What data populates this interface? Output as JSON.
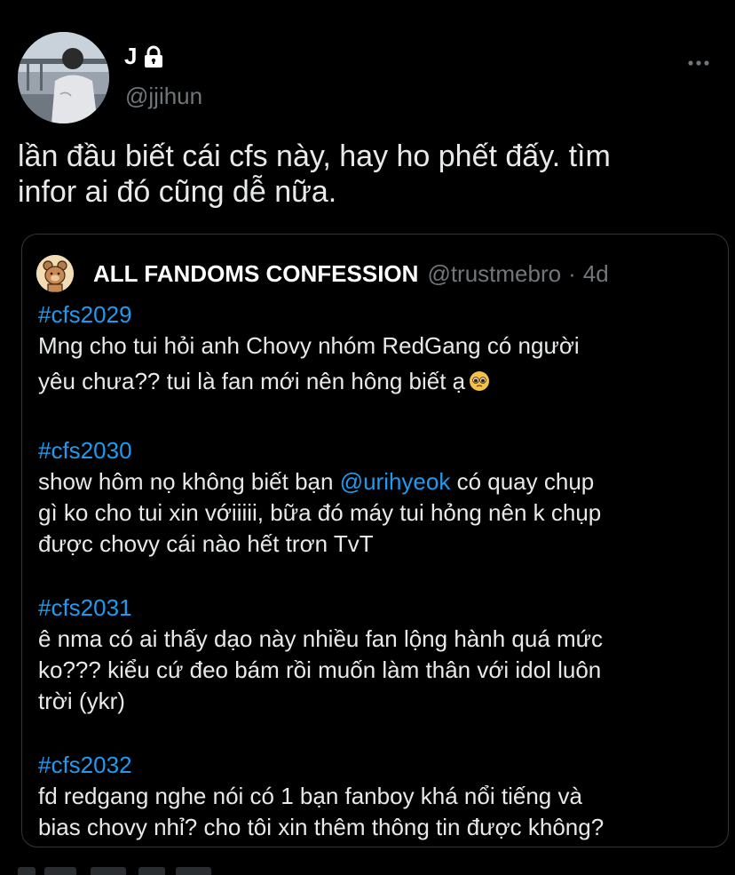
{
  "user": {
    "display_name": "J",
    "handle": "@jjihun",
    "avatar_icon": "profile-photo",
    "lock_icon": "lock-icon"
  },
  "tweet": {
    "text_line1": "lần đầu biết cái cfs này, hay ho phết đấy. tìm",
    "text_line2": "infor ai đó cũng dễ nữa."
  },
  "quote": {
    "name": "ALL FANDOMS CONFESSION",
    "handle": "@trustmebro",
    "separator": "·",
    "time": "4d",
    "posts": [
      {
        "tag": "#cfs2029",
        "line1": "Mng cho tui hỏi anh Chovy nhóm RedGang có người",
        "line2": "yêu chưa?? tui là fan mới nên hông biết ạ",
        "emoji": "pleading-face-emoji"
      },
      {
        "tag": "#cfs2030",
        "line1_pre": "show hôm nọ không biết bạn ",
        "mention": "@urihyeok",
        "line1_post": " có quay chụp",
        "line2": "gì ko cho tui xin vớiiiii, bữa đó máy tui hỏng nên k chụp",
        "line3": "được chovy cái nào hết trơn TvT"
      },
      {
        "tag": "#cfs2031",
        "line1": "ê nma có ai thấy dạo này nhiều fan lộng hành quá mức",
        "line2": "ko??? kiểu cứ đeo bám rồi muốn làm thân với idol luôn",
        "line3": "trời (ykr)"
      },
      {
        "tag": "#cfs2032",
        "line1": "fd redgang nghe nói có 1 bạn fanboy khá nổi tiếng và",
        "line2": "bias chovy nhỉ? cho tôi xin thêm thông tin được không?"
      }
    ]
  },
  "colors": {
    "background": "#000000",
    "text": "#e7e9ea",
    "secondary": "#71767b",
    "accent": "#1d9bf0",
    "border": "#333639"
  }
}
